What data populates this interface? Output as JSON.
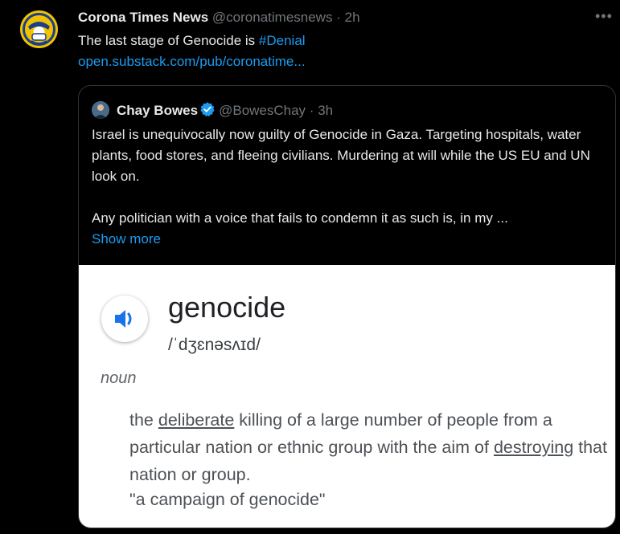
{
  "tweet": {
    "author_name": "Corona Times News",
    "author_handle": "@coronatimesnews",
    "separator": "·",
    "time": "2h",
    "more_icon": "more-horizontal-icon",
    "text": "The last stage of Genocide is ",
    "hashtag": "#Denial",
    "link": "open.substack.com/pub/coronatime..."
  },
  "quote": {
    "author_name": "Chay Bowes",
    "verified_icon": "verified-badge-icon",
    "author_handle": "@BowesChay",
    "separator": "·",
    "time": "3h",
    "paragraph1": "Israel is unequivocally now guilty of Genocide in Gaza. Targeting hospitals, water plants, food stores, and fleeing civilians. Murdering at will while the US EU and UN look on.",
    "paragraph2": "Any politician with a voice that  fails to condemn it as such is, in my ...",
    "show_more": "Show more"
  },
  "image": {
    "speaker_icon": "speaker-icon",
    "word": "genocide",
    "pronunciation": "/ˈdʒɛnəsʌɪd/",
    "part_of_speech": "noun",
    "def_part1": "the ",
    "def_underlined1": "deliberate",
    "def_part2": " killing of a large number of people from a particular nation or ethnic group with the aim of ",
    "def_underlined2": "destroying",
    "def_part3": " that nation or group.",
    "example": "\"a campaign of genocide\""
  },
  "colors": {
    "background": "#000000",
    "link": "#1d9bf0",
    "muted": "#71767b",
    "avatar": "#f2c200"
  }
}
